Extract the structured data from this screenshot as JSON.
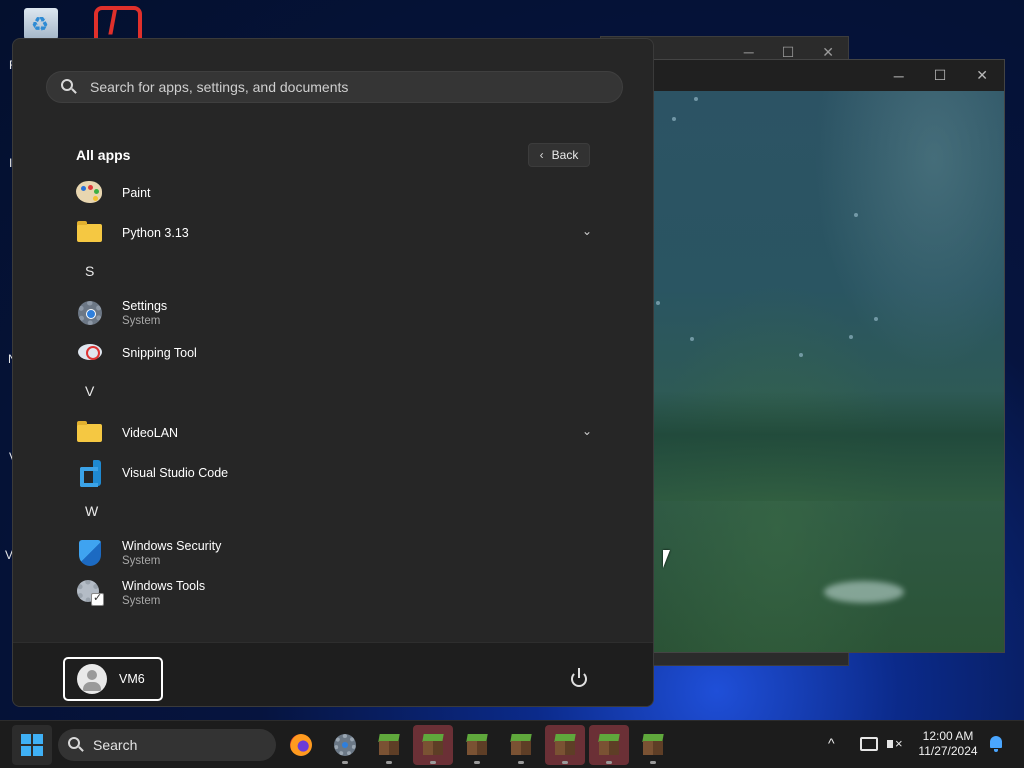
{
  "desktop": {
    "icons": [
      "recycle-bin-icon",
      "red-app-icon"
    ],
    "letters": [
      "R",
      "I",
      "N",
      "V",
      "V"
    ]
  },
  "background_windows": {
    "back_window_controls": [
      "─",
      "☐",
      "✕"
    ],
    "video_window_controls": [
      "─",
      "☐",
      "✕"
    ]
  },
  "start_menu": {
    "search": {
      "placeholder": "Search for apps, settings, and documents",
      "value": ""
    },
    "all_apps_title": "All apps",
    "back_label": "Back",
    "apps": [
      {
        "name": "Paint",
        "subtitle": "",
        "icon": "paint-icon",
        "expandable": false
      },
      {
        "name": "Python 3.13",
        "subtitle": "",
        "icon": "folder-icon",
        "expandable": true
      },
      {
        "name": "Settings",
        "subtitle": "System",
        "icon": "settings-gear-icon",
        "expandable": false
      },
      {
        "name": "Snipping Tool",
        "subtitle": "",
        "icon": "snipping-tool-icon",
        "expandable": false
      },
      {
        "name": "VideoLAN",
        "subtitle": "",
        "icon": "folder-icon",
        "expandable": true
      },
      {
        "name": "Visual Studio Code",
        "subtitle": "",
        "icon": "vscode-icon",
        "expandable": false
      },
      {
        "name": "Windows Security",
        "subtitle": "System",
        "icon": "windows-security-shield-icon",
        "expandable": false
      },
      {
        "name": "Windows Tools",
        "subtitle": "System",
        "icon": "windows-tools-icon",
        "expandable": false
      }
    ],
    "section_letters": [
      "S",
      "V",
      "W"
    ],
    "user": {
      "name": "VM6"
    },
    "power_icon": "power-icon"
  },
  "taskbar": {
    "search_label": "Search",
    "apps": [
      {
        "name": "firefox",
        "icon": "firefox-icon",
        "active": false
      },
      {
        "name": "settings",
        "icon": "settings-gear-icon",
        "active": false
      },
      {
        "name": "minecraft-1",
        "icon": "minecraft-grass-block-icon",
        "active": false
      },
      {
        "name": "minecraft-2",
        "icon": "minecraft-grass-block-icon",
        "active": true
      },
      {
        "name": "minecraft-3",
        "icon": "minecraft-grass-block-icon",
        "active": false
      },
      {
        "name": "minecraft-4",
        "icon": "minecraft-grass-block-icon",
        "active": false
      },
      {
        "name": "minecraft-5",
        "icon": "minecraft-grass-block-icon",
        "active": true
      },
      {
        "name": "minecraft-6",
        "icon": "minecraft-grass-block-icon",
        "active": true
      },
      {
        "name": "minecraft-7",
        "icon": "minecraft-grass-block-icon",
        "active": false
      }
    ],
    "tray": {
      "chevron": "^",
      "time": "12:00 AM",
      "date": "11/27/2024"
    }
  },
  "colors": {
    "menu_bg": "#262626",
    "taskbar_bg": "#1c1c1c",
    "accent": "#3fb0f5",
    "active_app_bg": "#6b3036"
  }
}
